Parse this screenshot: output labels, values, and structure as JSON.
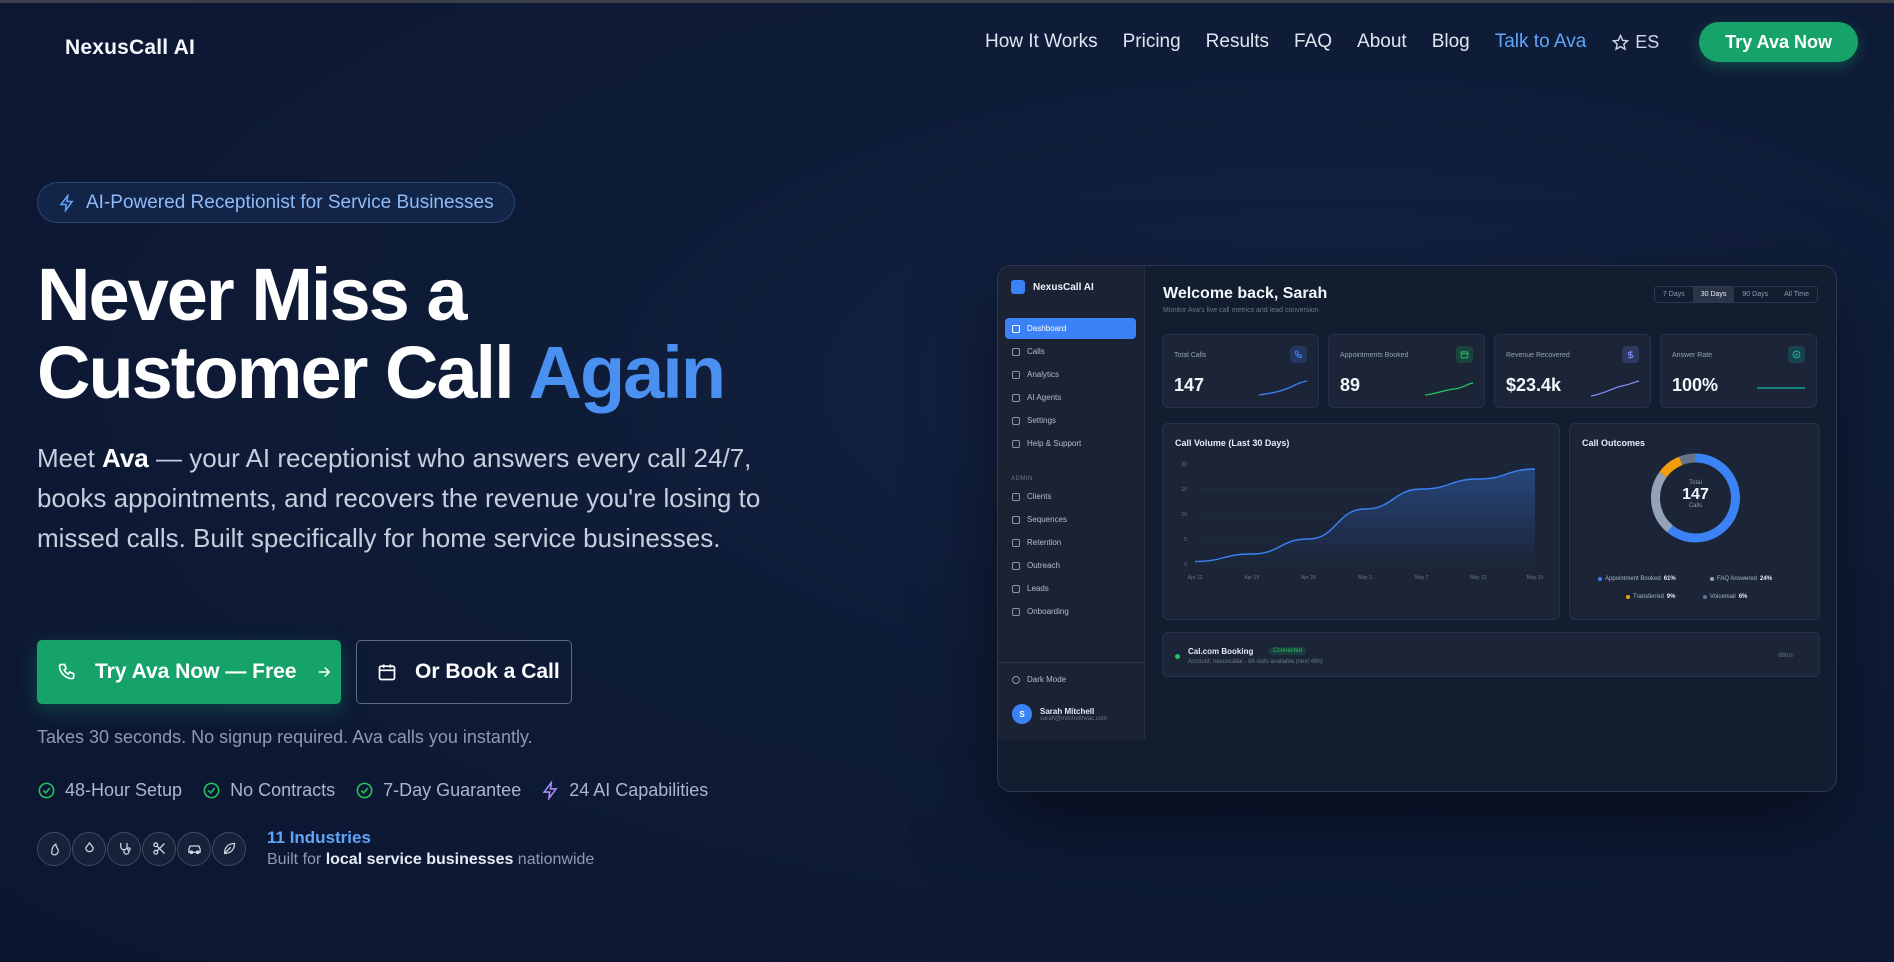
{
  "nav": {
    "logo": "NexusCall AI",
    "links": [
      "How It Works",
      "Pricing",
      "Results",
      "FAQ",
      "About",
      "Blog",
      "Talk to Ava"
    ],
    "lang": "ES",
    "cta": "Try Ava Now"
  },
  "hero": {
    "badge": "AI-Powered Receptionist for Service Businesses",
    "title_line1": "Never Miss a",
    "title_line2": "Customer Call",
    "title_accent": "Again",
    "lead_prefix": "Meet ",
    "lead_name": "Ava",
    "lead_rest": " — your AI receptionist who answers every call 24/7, books appointments, and recovers the revenue you're losing to missed calls. Built specifically for home service businesses.",
    "primary_cta": "Try Ava Now — Free",
    "secondary_cta": "Or Book a Call",
    "note": "Takes 30 seconds. No signup required. Ava calls you instantly.",
    "features": [
      "48-Hour Setup",
      "No Contracts",
      "7-Day Guarantee",
      "24 AI Capabilities"
    ],
    "industries_title": "11 Industries",
    "industries_sub_prefix": "Built for ",
    "industries_sub_bold": "local service businesses",
    "industries_sub_suffix": " nationwide",
    "industry_icons": [
      "flame-icon",
      "droplet-icon",
      "stethoscope-icon",
      "scissors-icon",
      "car-icon",
      "leaf-icon"
    ]
  },
  "dashboard": {
    "app_name": "NexusCall AI",
    "nav": [
      "Dashboard",
      "Calls",
      "Analytics",
      "AI Agents",
      "Settings",
      "Help & Support"
    ],
    "admin_label": "ADMIN",
    "admin_nav": [
      "Clients",
      "Sequences",
      "Retention",
      "Outreach",
      "Leads",
      "Onboarding"
    ],
    "dark_mode": "Dark Mode",
    "user_initial": "S",
    "user_name": "Sarah Mitchell",
    "user_email": "sarah@mitchellhvac.com",
    "welcome": "Welcome back, Sarah",
    "welcome_sub": "Monitor Ava's live call metrics and lead conversion",
    "ranges": [
      "7 Days",
      "30 Days",
      "90 Days",
      "All Time"
    ],
    "kpis": [
      {
        "label": "Total Calls",
        "value": "147",
        "color": "#3b82f6"
      },
      {
        "label": "Appointments Booked",
        "value": "89",
        "color": "#22c55e"
      },
      {
        "label": "Revenue Recovered",
        "value": "$23.4k",
        "color": "#818cf8"
      },
      {
        "label": "Answer Rate",
        "value": "100%",
        "color": "#14b8a6"
      }
    ],
    "call_volume_title": "Call Volume (Last 30 Days)",
    "outcomes_title": "Call Outcomes",
    "donut_total_label": "Total",
    "donut_total": "147",
    "donut_unit": "Calls",
    "booking_title": "Cal.com Booking",
    "booking_status": "Connected",
    "booking_sub": "Account: nexuscallai · 88 slots available (next 48h)",
    "booking_latency": "68ms"
  },
  "chart_data": [
    {
      "type": "area",
      "title": "Call Volume (Last 30 Days)",
      "x": [
        "Apr 12",
        "Apr 19",
        "Apr 26",
        "May 3",
        "May 7",
        "May 12",
        "May 19"
      ],
      "y": [
        0.5,
        2,
        5,
        11,
        15,
        17,
        19
      ],
      "ylim": [
        0,
        20
      ],
      "yticks": [
        0,
        5,
        10,
        15,
        20
      ],
      "color": "#3b82f6"
    },
    {
      "type": "pie",
      "title": "Call Outcomes",
      "labels": [
        "Appointment Booked",
        "FAQ Answered",
        "Transferred",
        "Voicemail"
      ],
      "values": [
        61,
        24,
        9,
        6
      ],
      "colors": [
        "#3b82f6",
        "#94a3b8",
        "#f59e0b",
        "#64748b"
      ]
    }
  ]
}
